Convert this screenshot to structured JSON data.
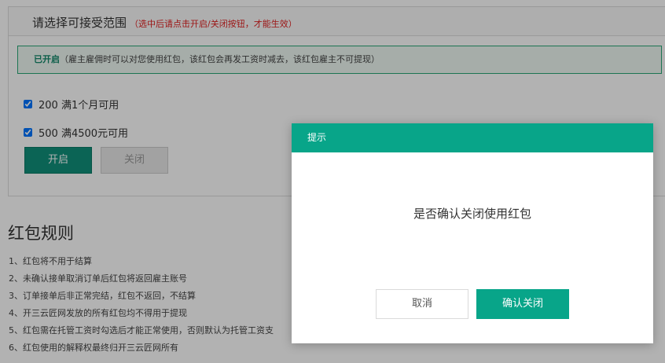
{
  "panel": {
    "title": "请选择可接受范围",
    "hint": "（选中后请点击开启/关闭按钮，才能生效）",
    "status_label": "已开启",
    "status_text": "（雇主雇佣时可以对您使用红包，该红包会再发工资时减去，该红包雇主不可提现）",
    "options": [
      {
        "label": "200 满1个月可用",
        "checked": true
      },
      {
        "label": "500 满4500元可用",
        "checked": true
      }
    ],
    "on_button": "开启",
    "off_button": "关闭"
  },
  "rules": {
    "title": "红包规则",
    "items": [
      "1、红包将不用于结算",
      "2、未确认接单取消订单后红包将返回雇主账号",
      "3、订单接单后非正常完结，红包不返回，不结算",
      "4、开三云匠网发放的所有红包均不得用于提现",
      "5、红包需在托管工资时勾选后才能正常使用，否则默认为托管工资支",
      "6、红包使用的解释权最终归开三云匠网所有"
    ]
  },
  "dialog": {
    "title": "提示",
    "message": "是否确认关闭使用红包",
    "cancel": "取消",
    "confirm": "确认关闭"
  },
  "colors": {
    "primary": "#08a589",
    "hint": "#e02020"
  }
}
